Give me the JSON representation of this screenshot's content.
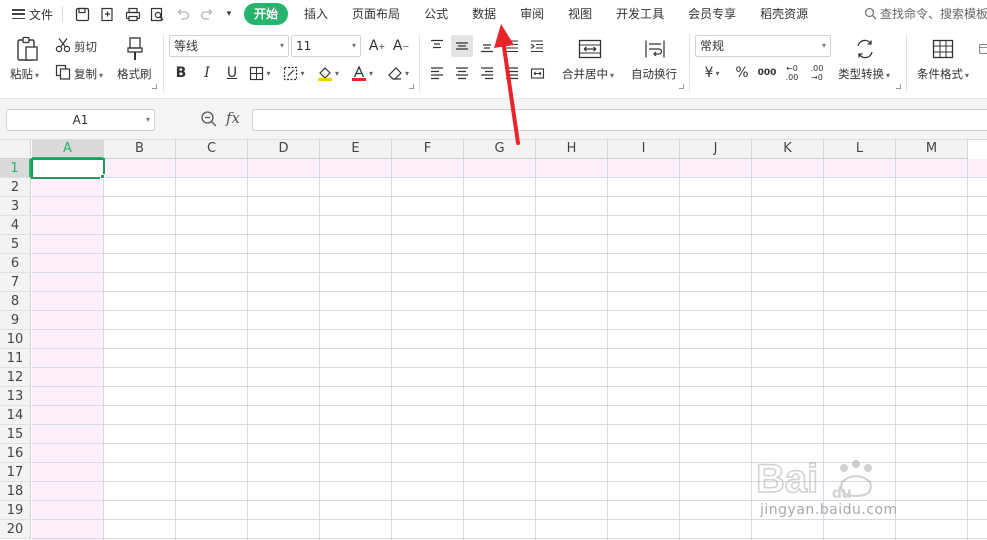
{
  "file_menu": {
    "label": "文件"
  },
  "tabs": [
    {
      "label": "开始",
      "active": true
    },
    {
      "label": "插入"
    },
    {
      "label": "页面布局"
    },
    {
      "label": "公式"
    },
    {
      "label": "数据"
    },
    {
      "label": "审阅"
    },
    {
      "label": "视图"
    },
    {
      "label": "开发工具"
    },
    {
      "label": "会员专享"
    },
    {
      "label": "稻壳资源"
    }
  ],
  "search": {
    "text": "查找命令、搜索模板"
  },
  "ribbon": {
    "paste": "粘贴",
    "cut": "剪切",
    "copy": "复制",
    "format_painter": "格式刷",
    "font_name": "等线",
    "font_size": "11",
    "merge_center": "合并居中",
    "wrap_text": "自动换行",
    "number_format": "常规",
    "currency": "¥",
    "percent": "%",
    "thousands": "000",
    "type_convert": "类型转换",
    "conditional_format": "条件格式"
  },
  "formula_bar": {
    "cell_ref": "A1",
    "fx": "fx",
    "formula": ""
  },
  "grid": {
    "columns": [
      "A",
      "B",
      "C",
      "D",
      "E",
      "F",
      "G",
      "H",
      "I",
      "J",
      "K",
      "L",
      "M"
    ],
    "rows": [
      "1",
      "2",
      "3",
      "4",
      "5",
      "6",
      "7",
      "8",
      "9",
      "10",
      "11",
      "12",
      "13",
      "14",
      "15",
      "16",
      "17",
      "18",
      "19",
      "20"
    ],
    "active_column": "A",
    "active_row": "1"
  },
  "colors": {
    "accent": "#26b36b",
    "annotation": "#e8242b",
    "highlight": "#fdf0fb"
  },
  "watermark": {
    "brand": "Baidu经验",
    "url": "jingyan.baidu.com"
  }
}
